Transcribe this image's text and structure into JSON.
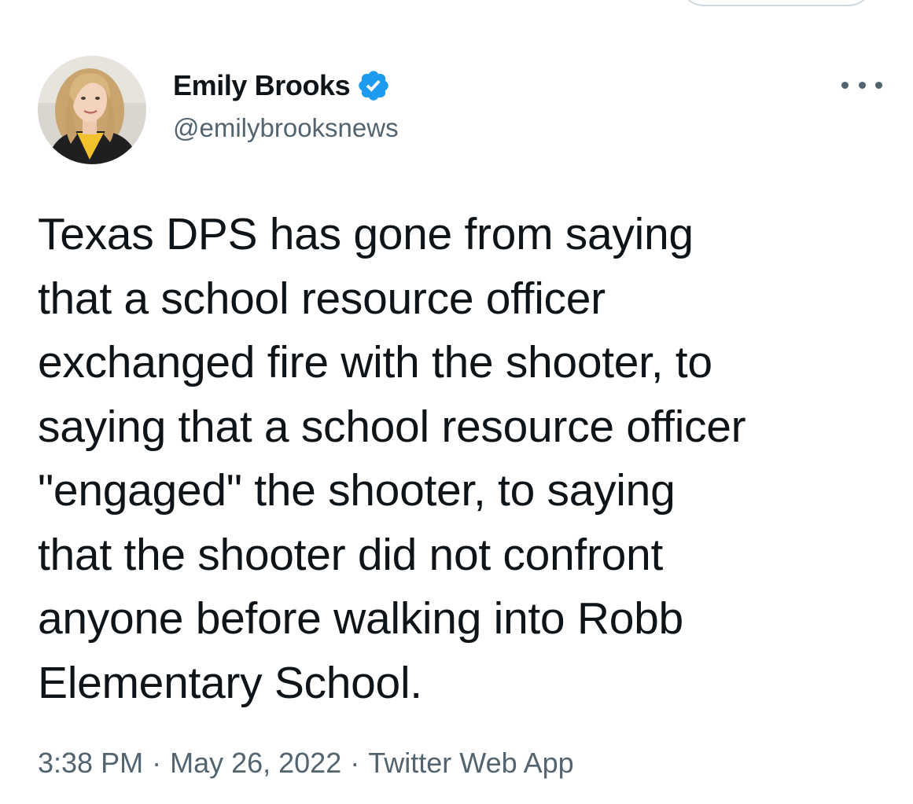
{
  "tweet": {
    "author": {
      "display_name": "Emily Brooks",
      "handle": "@emilybrooksnews",
      "verified": true,
      "avatar_icon": "profile-photo"
    },
    "text": "Texas DPS has gone from saying\nthat a school resource officer\nexchanged fire with the shooter, to\nsaying that a school resource officer\n\"engaged\" the shooter, to saying\nthat the shooter did not confront\nanyone before walking into Robb\nElementary School.",
    "time": "3:38 PM",
    "separator": "·",
    "date": "May 26, 2022",
    "source": "Twitter Web App",
    "more_icon": "more-horizontal-icon"
  },
  "colors": {
    "text_primary": "#0f1419",
    "text_secondary": "#536471",
    "verified_blue": "#1d9bf0",
    "border": "#cfd9de"
  }
}
